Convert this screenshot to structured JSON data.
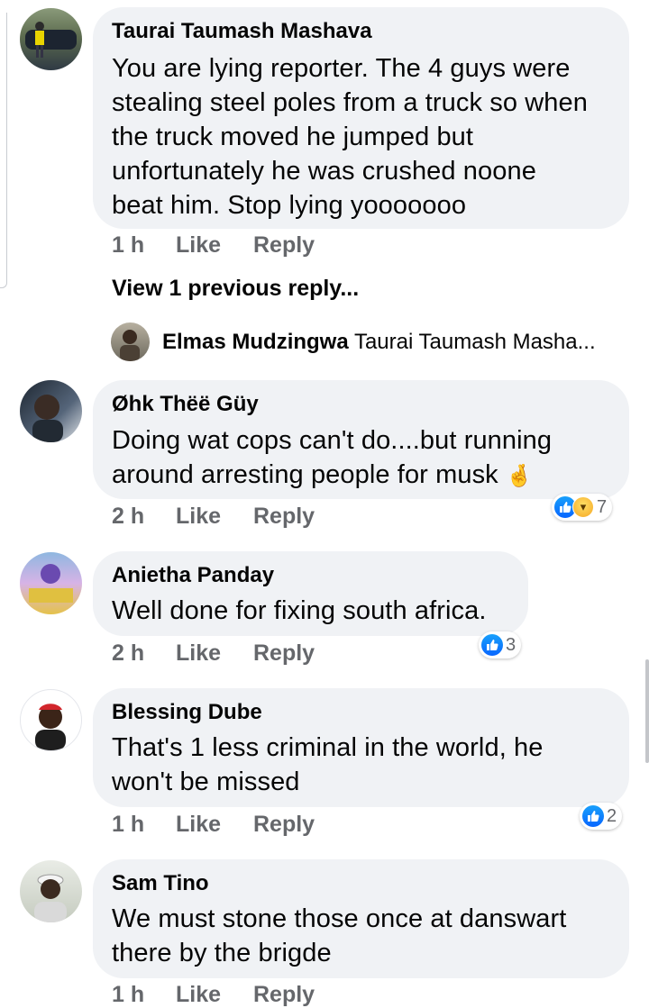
{
  "comments": [
    {
      "author": "Taurai Taumash Mashava",
      "lines": [
        "You are lying reporter. The 4 guys were",
        "stealing steel poles from a truck so when",
        "the truck moved he jumped but",
        "unfortunately he was crushed noone",
        "beat him. Stop lying yooooooo"
      ],
      "time": "1 h",
      "like": "Like",
      "reply": "Reply"
    },
    {
      "author": "Øhk Thëë Güy",
      "lines": [
        "Doing wat cops can't do....but running",
        "around arresting people for musk"
      ],
      "emoji": "🤞",
      "time": "2 h",
      "like": "Like",
      "reply": "Reply",
      "reaction_count": "7"
    },
    {
      "author": "Anietha Panday",
      "lines": [
        "Well done for fixing south africa."
      ],
      "time": "2 h",
      "like": "Like",
      "reply": "Reply",
      "reaction_count": "3"
    },
    {
      "author": "Blessing Dube",
      "lines": [
        "That's 1 less criminal in the world, he",
        "won't be missed"
      ],
      "time": "1 h",
      "like": "Like",
      "reply": "Reply",
      "reaction_count": "2"
    },
    {
      "author": "Sam Tino",
      "lines": [
        "We must stone those once at danswart",
        "there by the brigde"
      ],
      "time": "1 h",
      "like": "Like",
      "reply": "Reply"
    }
  ],
  "view_previous": "View 1 previous reply...",
  "reply_preview": {
    "author": "Elmas Mudzingwa",
    "text": "Taurai Taumash Masha..."
  },
  "colors": {
    "bubble": "#f0f2f5",
    "meta": "#65676b",
    "like_blue": "#0866ff"
  },
  "icons": [
    "thumbs-up-icon",
    "haha-icon"
  ]
}
